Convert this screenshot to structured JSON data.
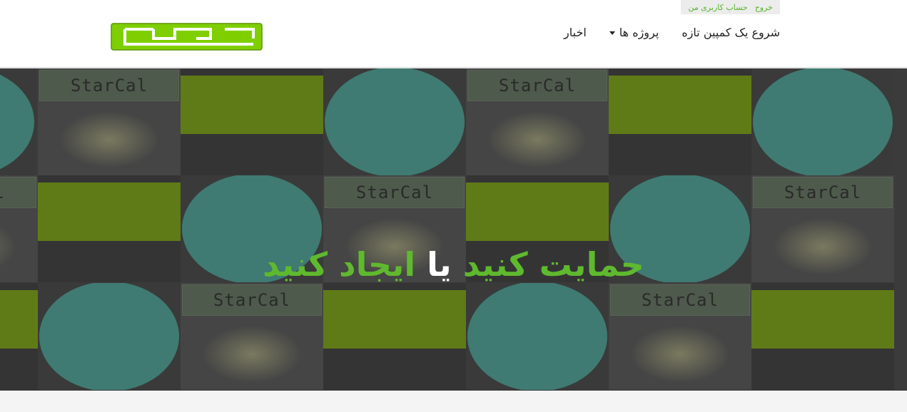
{
  "account": {
    "logout": "خروج",
    "my_account": "حساب کاربری من"
  },
  "logo": {
    "icon": "kabal-logo",
    "color": "#7fcf00"
  },
  "nav": {
    "items": [
      {
        "label": "شروع یک کمپین تازه"
      },
      {
        "label": "پروژه ها",
        "dropdown": true
      },
      {
        "label": "اخبار"
      }
    ]
  },
  "hero": {
    "title_part1": "حمایت کنید",
    "title_part2": "یا",
    "title_part3": "ایجاد کنید",
    "tile_label": "StarCal",
    "accent": "#5fb92e"
  }
}
